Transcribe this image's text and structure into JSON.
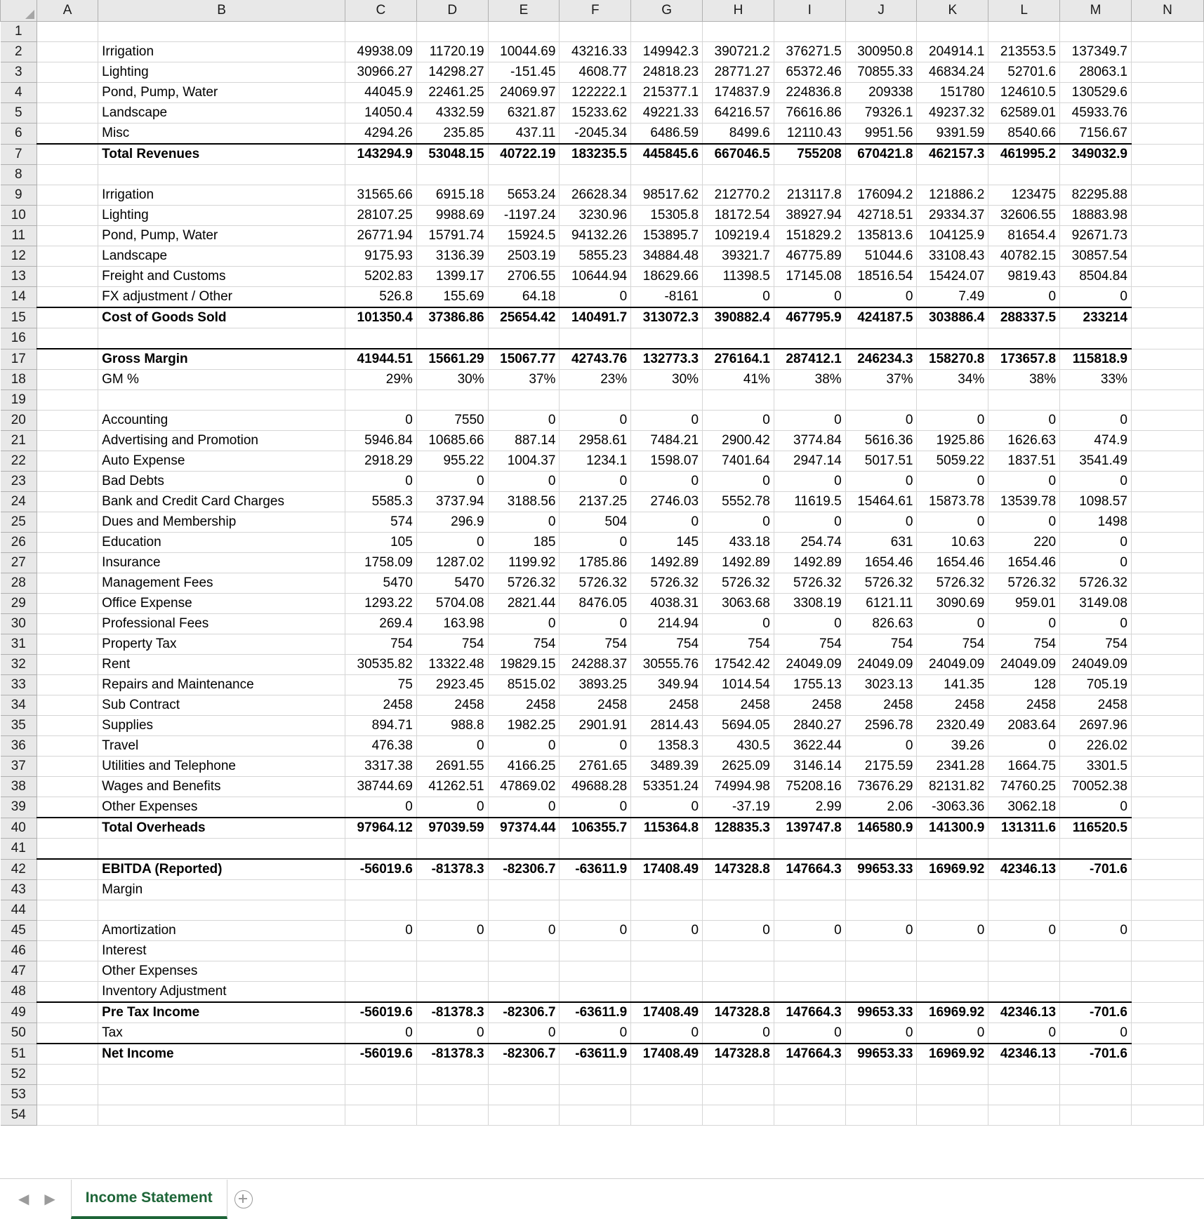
{
  "sheet": {
    "name": "Income Statement",
    "columns": [
      "A",
      "B",
      "C",
      "D",
      "E",
      "F",
      "G",
      "H",
      "I",
      "J",
      "K",
      "L",
      "M",
      "N"
    ],
    "num_columns": [
      "C",
      "D",
      "E",
      "F",
      "G",
      "H",
      "I",
      "J",
      "K",
      "L",
      "M"
    ],
    "accent_color": "#1d6537",
    "add_sheet_label": "+",
    "prev_arrow": "◀",
    "next_arrow": "▶"
  },
  "rows": [
    {
      "n": 1,
      "label": "",
      "bold": false,
      "values": [
        "",
        "",
        "",
        "",
        "",
        "",
        "",
        "",
        "",
        "",
        ""
      ]
    },
    {
      "n": 2,
      "label": "Irrigation",
      "bold": false,
      "values": [
        "49938.09",
        "11720.19",
        "10044.69",
        "43216.33",
        "149942.3",
        "390721.2",
        "376271.5",
        "300950.8",
        "204914.1",
        "213553.5",
        "137349.7"
      ]
    },
    {
      "n": 3,
      "label": "Lighting",
      "bold": false,
      "values": [
        "30966.27",
        "14298.27",
        "-151.45",
        "4608.77",
        "24818.23",
        "28771.27",
        "65372.46",
        "70855.33",
        "46834.24",
        "52701.6",
        "28063.1"
      ]
    },
    {
      "n": 4,
      "label": "Pond, Pump, Water",
      "bold": false,
      "values": [
        "44045.9",
        "22461.25",
        "24069.97",
        "122222.1",
        "215377.1",
        "174837.9",
        "224836.8",
        "209338",
        "151780",
        "124610.5",
        "130529.6"
      ]
    },
    {
      "n": 5,
      "label": "Landscape",
      "bold": false,
      "values": [
        "14050.4",
        "4332.59",
        "6321.87",
        "15233.62",
        "49221.33",
        "64216.57",
        "76616.86",
        "79326.1",
        "49237.32",
        "62589.01",
        "45933.76"
      ]
    },
    {
      "n": 6,
      "label": "Misc",
      "bold": false,
      "values": [
        "4294.26",
        "235.85",
        "437.11",
        "-2045.34",
        "6486.59",
        "8499.6",
        "12110.43",
        "9951.56",
        "9391.59",
        "8540.66",
        "7156.67"
      ]
    },
    {
      "n": 7,
      "label": "Total Revenues",
      "bold": true,
      "topline": true,
      "values": [
        "143294.9",
        "53048.15",
        "40722.19",
        "183235.5",
        "445845.6",
        "667046.5",
        "755208",
        "670421.8",
        "462157.3",
        "461995.2",
        "349032.9"
      ]
    },
    {
      "n": 8,
      "label": "",
      "bold": false,
      "values": [
        "",
        "",
        "",
        "",
        "",
        "",
        "",
        "",
        "",
        "",
        ""
      ]
    },
    {
      "n": 9,
      "label": "Irrigation",
      "bold": false,
      "values": [
        "31565.66",
        "6915.18",
        "5653.24",
        "26628.34",
        "98517.62",
        "212770.2",
        "213117.8",
        "176094.2",
        "121886.2",
        "123475",
        "82295.88"
      ]
    },
    {
      "n": 10,
      "label": "Lighting",
      "bold": false,
      "values": [
        "28107.25",
        "9988.69",
        "-1197.24",
        "3230.96",
        "15305.8",
        "18172.54",
        "38927.94",
        "42718.51",
        "29334.37",
        "32606.55",
        "18883.98"
      ]
    },
    {
      "n": 11,
      "label": "Pond, Pump, Water",
      "bold": false,
      "values": [
        "26771.94",
        "15791.74",
        "15924.5",
        "94132.26",
        "153895.7",
        "109219.4",
        "151829.2",
        "135813.6",
        "104125.9",
        "81654.4",
        "92671.73"
      ]
    },
    {
      "n": 12,
      "label": "Landscape",
      "bold": false,
      "values": [
        "9175.93",
        "3136.39",
        "2503.19",
        "5855.23",
        "34884.48",
        "39321.7",
        "46775.89",
        "51044.6",
        "33108.43",
        "40782.15",
        "30857.54"
      ]
    },
    {
      "n": 13,
      "label": "Freight and Customs",
      "bold": false,
      "values": [
        "5202.83",
        "1399.17",
        "2706.55",
        "10644.94",
        "18629.66",
        "11398.5",
        "17145.08",
        "18516.54",
        "15424.07",
        "9819.43",
        "8504.84"
      ]
    },
    {
      "n": 14,
      "label": "FX adjustment / Other",
      "bold": false,
      "values": [
        "526.8",
        "155.69",
        "64.18",
        "0",
        "-8161",
        "0",
        "0",
        "0",
        "7.49",
        "0",
        "0"
      ]
    },
    {
      "n": 15,
      "label": "Cost of Goods Sold",
      "bold": true,
      "topline": true,
      "values": [
        "101350.4",
        "37386.86",
        "25654.42",
        "140491.7",
        "313072.3",
        "390882.4",
        "467795.9",
        "424187.5",
        "303886.4",
        "288337.5",
        "233214"
      ]
    },
    {
      "n": 16,
      "label": "",
      "bold": false,
      "values": [
        "",
        "",
        "",
        "",
        "",
        "",
        "",
        "",
        "",
        "",
        ""
      ]
    },
    {
      "n": 17,
      "label": "Gross Margin",
      "bold": true,
      "topline": true,
      "values": [
        "41944.51",
        "15661.29",
        "15067.77",
        "42743.76",
        "132773.3",
        "276164.1",
        "287412.1",
        "246234.3",
        "158270.8",
        "173657.8",
        "115818.9"
      ]
    },
    {
      "n": 18,
      "label": "GM %",
      "bold": false,
      "values": [
        "29%",
        "30%",
        "37%",
        "23%",
        "30%",
        "41%",
        "38%",
        "37%",
        "34%",
        "38%",
        "33%"
      ]
    },
    {
      "n": 19,
      "label": "",
      "bold": false,
      "values": [
        "",
        "",
        "",
        "",
        "",
        "",
        "",
        "",
        "",
        "",
        ""
      ]
    },
    {
      "n": 20,
      "label": "Accounting",
      "bold": false,
      "values": [
        "0",
        "7550",
        "0",
        "0",
        "0",
        "0",
        "0",
        "0",
        "0",
        "0",
        "0"
      ]
    },
    {
      "n": 21,
      "label": "Advertising and Promotion",
      "bold": false,
      "values": [
        "5946.84",
        "10685.66",
        "887.14",
        "2958.61",
        "7484.21",
        "2900.42",
        "3774.84",
        "5616.36",
        "1925.86",
        "1626.63",
        "474.9"
      ]
    },
    {
      "n": 22,
      "label": "Auto Expense",
      "bold": false,
      "values": [
        "2918.29",
        "955.22",
        "1004.37",
        "1234.1",
        "1598.07",
        "7401.64",
        "2947.14",
        "5017.51",
        "5059.22",
        "1837.51",
        "3541.49"
      ]
    },
    {
      "n": 23,
      "label": "Bad Debts",
      "bold": false,
      "values": [
        "0",
        "0",
        "0",
        "0",
        "0",
        "0",
        "0",
        "0",
        "0",
        "0",
        "0"
      ]
    },
    {
      "n": 24,
      "label": "Bank and Credit Card Charges",
      "bold": false,
      "values": [
        "5585.3",
        "3737.94",
        "3188.56",
        "2137.25",
        "2746.03",
        "5552.78",
        "11619.5",
        "15464.61",
        "15873.78",
        "13539.78",
        "1098.57"
      ]
    },
    {
      "n": 25,
      "label": "Dues and Membership",
      "bold": false,
      "values": [
        "574",
        "296.9",
        "0",
        "504",
        "0",
        "0",
        "0",
        "0",
        "0",
        "0",
        "1498"
      ]
    },
    {
      "n": 26,
      "label": "Education",
      "bold": false,
      "values": [
        "105",
        "0",
        "185",
        "0",
        "145",
        "433.18",
        "254.74",
        "631",
        "10.63",
        "220",
        "0"
      ]
    },
    {
      "n": 27,
      "label": "Insurance",
      "bold": false,
      "values": [
        "1758.09",
        "1287.02",
        "1199.92",
        "1785.86",
        "1492.89",
        "1492.89",
        "1492.89",
        "1654.46",
        "1654.46",
        "1654.46",
        "0"
      ]
    },
    {
      "n": 28,
      "label": "Management Fees",
      "bold": false,
      "values": [
        "5470",
        "5470",
        "5726.32",
        "5726.32",
        "5726.32",
        "5726.32",
        "5726.32",
        "5726.32",
        "5726.32",
        "5726.32",
        "5726.32"
      ]
    },
    {
      "n": 29,
      "label": "Office Expense",
      "bold": false,
      "values": [
        "1293.22",
        "5704.08",
        "2821.44",
        "8476.05",
        "4038.31",
        "3063.68",
        "3308.19",
        "6121.11",
        "3090.69",
        "959.01",
        "3149.08"
      ]
    },
    {
      "n": 30,
      "label": "Professional Fees",
      "bold": false,
      "values": [
        "269.4",
        "163.98",
        "0",
        "0",
        "214.94",
        "0",
        "0",
        "826.63",
        "0",
        "0",
        "0"
      ]
    },
    {
      "n": 31,
      "label": "Property Tax",
      "bold": false,
      "values": [
        "754",
        "754",
        "754",
        "754",
        "754",
        "754",
        "754",
        "754",
        "754",
        "754",
        "754"
      ]
    },
    {
      "n": 32,
      "label": "Rent",
      "bold": false,
      "values": [
        "30535.82",
        "13322.48",
        "19829.15",
        "24288.37",
        "30555.76",
        "17542.42",
        "24049.09",
        "24049.09",
        "24049.09",
        "24049.09",
        "24049.09"
      ]
    },
    {
      "n": 33,
      "label": "Repairs and Maintenance",
      "bold": false,
      "values": [
        "75",
        "2923.45",
        "8515.02",
        "3893.25",
        "349.94",
        "1014.54",
        "1755.13",
        "3023.13",
        "141.35",
        "128",
        "705.19"
      ]
    },
    {
      "n": 34,
      "label": "Sub Contract",
      "bold": false,
      "values": [
        "2458",
        "2458",
        "2458",
        "2458",
        "2458",
        "2458",
        "2458",
        "2458",
        "2458",
        "2458",
        "2458"
      ]
    },
    {
      "n": 35,
      "label": "Supplies",
      "bold": false,
      "values": [
        "894.71",
        "988.8",
        "1982.25",
        "2901.91",
        "2814.43",
        "5694.05",
        "2840.27",
        "2596.78",
        "2320.49",
        "2083.64",
        "2697.96"
      ]
    },
    {
      "n": 36,
      "label": "Travel",
      "bold": false,
      "values": [
        "476.38",
        "0",
        "0",
        "0",
        "1358.3",
        "430.5",
        "3622.44",
        "0",
        "39.26",
        "0",
        "226.02"
      ]
    },
    {
      "n": 37,
      "label": "Utilities and Telephone",
      "bold": false,
      "values": [
        "3317.38",
        "2691.55",
        "4166.25",
        "2761.65",
        "3489.39",
        "2625.09",
        "3146.14",
        "2175.59",
        "2341.28",
        "1664.75",
        "3301.5"
      ]
    },
    {
      "n": 38,
      "label": "Wages and Benefits",
      "bold": false,
      "values": [
        "38744.69",
        "41262.51",
        "47869.02",
        "49688.28",
        "53351.24",
        "74994.98",
        "75208.16",
        "73676.29",
        "82131.82",
        "74760.25",
        "70052.38"
      ]
    },
    {
      "n": 39,
      "label": "Other Expenses",
      "bold": false,
      "values": [
        "0",
        "0",
        "0",
        "0",
        "0",
        "-37.19",
        "2.99",
        "2.06",
        "-3063.36",
        "3062.18",
        "0"
      ]
    },
    {
      "n": 40,
      "label": "Total Overheads",
      "bold": true,
      "topline": true,
      "values": [
        "97964.12",
        "97039.59",
        "97374.44",
        "106355.7",
        "115364.8",
        "128835.3",
        "139747.8",
        "146580.9",
        "141300.9",
        "131311.6",
        "116520.5"
      ]
    },
    {
      "n": 41,
      "label": "",
      "bold": false,
      "values": [
        "",
        "",
        "",
        "",
        "",
        "",
        "",
        "",
        "",
        "",
        ""
      ]
    },
    {
      "n": 42,
      "label": "EBITDA (Reported)",
      "bold": true,
      "topline": true,
      "values": [
        "-56019.6",
        "-81378.3",
        "-82306.7",
        "-63611.9",
        "17408.49",
        "147328.8",
        "147664.3",
        "99653.33",
        "16969.92",
        "42346.13",
        "-701.6"
      ]
    },
    {
      "n": 43,
      "label": "Margin",
      "bold": false,
      "values": [
        "",
        "",
        "",
        "",
        "",
        "",
        "",
        "",
        "",
        "",
        ""
      ]
    },
    {
      "n": 44,
      "label": "",
      "bold": false,
      "values": [
        "",
        "",
        "",
        "",
        "",
        "",
        "",
        "",
        "",
        "",
        ""
      ]
    },
    {
      "n": 45,
      "label": "Amortization",
      "bold": false,
      "values": [
        "0",
        "0",
        "0",
        "0",
        "0",
        "0",
        "0",
        "0",
        "0",
        "0",
        "0"
      ]
    },
    {
      "n": 46,
      "label": "Interest",
      "bold": false,
      "values": [
        "",
        "",
        "",
        "",
        "",
        "",
        "",
        "",
        "",
        "",
        ""
      ]
    },
    {
      "n": 47,
      "label": "Other Expenses",
      "bold": false,
      "values": [
        "",
        "",
        "",
        "",
        "",
        "",
        "",
        "",
        "",
        "",
        ""
      ]
    },
    {
      "n": 48,
      "label": "Inventory Adjustment",
      "bold": false,
      "values": [
        "",
        "",
        "",
        "",
        "",
        "",
        "",
        "",
        "",
        "",
        ""
      ]
    },
    {
      "n": 49,
      "label": "Pre Tax Income",
      "bold": true,
      "topline": true,
      "values": [
        "-56019.6",
        "-81378.3",
        "-82306.7",
        "-63611.9",
        "17408.49",
        "147328.8",
        "147664.3",
        "99653.33",
        "16969.92",
        "42346.13",
        "-701.6"
      ]
    },
    {
      "n": 50,
      "label": "Tax",
      "bold": false,
      "values": [
        "0",
        "0",
        "0",
        "0",
        "0",
        "0",
        "0",
        "0",
        "0",
        "0",
        "0"
      ]
    },
    {
      "n": 51,
      "label": "Net Income",
      "bold": true,
      "topline": true,
      "values": [
        "-56019.6",
        "-81378.3",
        "-82306.7",
        "-63611.9",
        "17408.49",
        "147328.8",
        "147664.3",
        "99653.33",
        "16969.92",
        "42346.13",
        "-701.6"
      ]
    },
    {
      "n": 52,
      "label": "",
      "bold": false,
      "values": [
        "",
        "",
        "",
        "",
        "",
        "",
        "",
        "",
        "",
        "",
        ""
      ]
    },
    {
      "n": 53,
      "label": "",
      "bold": false,
      "values": [
        "",
        "",
        "",
        "",
        "",
        "",
        "",
        "",
        "",
        "",
        ""
      ]
    },
    {
      "n": 54,
      "label": "",
      "bold": false,
      "partial": true,
      "values": [
        "",
        "",
        "",
        "",
        "",
        "",
        "",
        "",
        "",
        "",
        ""
      ]
    }
  ]
}
